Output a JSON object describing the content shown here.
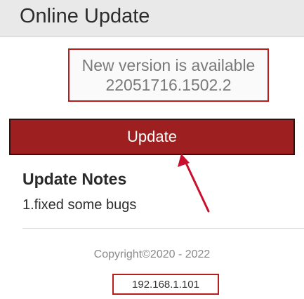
{
  "header": {
    "title": "Online Update"
  },
  "version": {
    "line1": "New version is available",
    "line2": "22051716.1502.2"
  },
  "update_button": {
    "label": "Update"
  },
  "notes": {
    "title": "Update Notes",
    "body": "1.fixed some bugs"
  },
  "footer": {
    "copyright": "Copyright©2020 - 2022",
    "ip": "192.168.1.101"
  },
  "colors": {
    "accent": "#9d1f1f",
    "highlight_border": "#b61d1d",
    "annotation_arrow": "#c8102e"
  }
}
